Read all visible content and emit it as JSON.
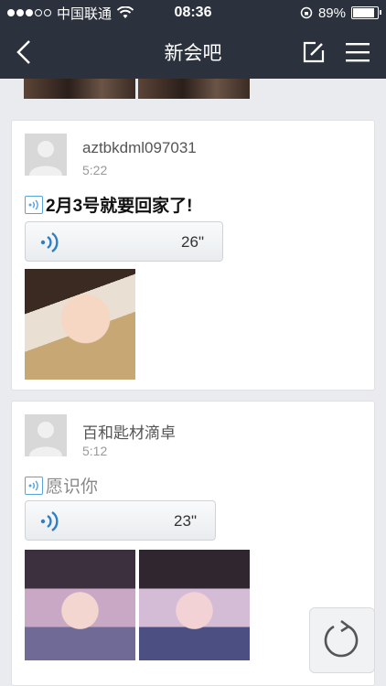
{
  "status_bar": {
    "carrier": "中国联通",
    "time": "08:36",
    "battery": "89%",
    "battery_level": 0.89
  },
  "nav": {
    "title": "新会吧",
    "icons": [
      "back-arrow-icon",
      "compose-icon",
      "menu-icon"
    ]
  },
  "posts": [
    {
      "username": "aztbkdml097031",
      "time": "5:22",
      "title": "2月3号就要回家了!",
      "voice_duration": "26\"",
      "photos": 1
    },
    {
      "username": "百和匙材滴卓",
      "time": "5:12",
      "title": "愿识你",
      "voice_duration": "23\"",
      "photos": 2
    }
  ],
  "colors": {
    "top_bar": "#2b313d",
    "voice_accent": "#2e7fc2",
    "background": "#e9ebee"
  }
}
